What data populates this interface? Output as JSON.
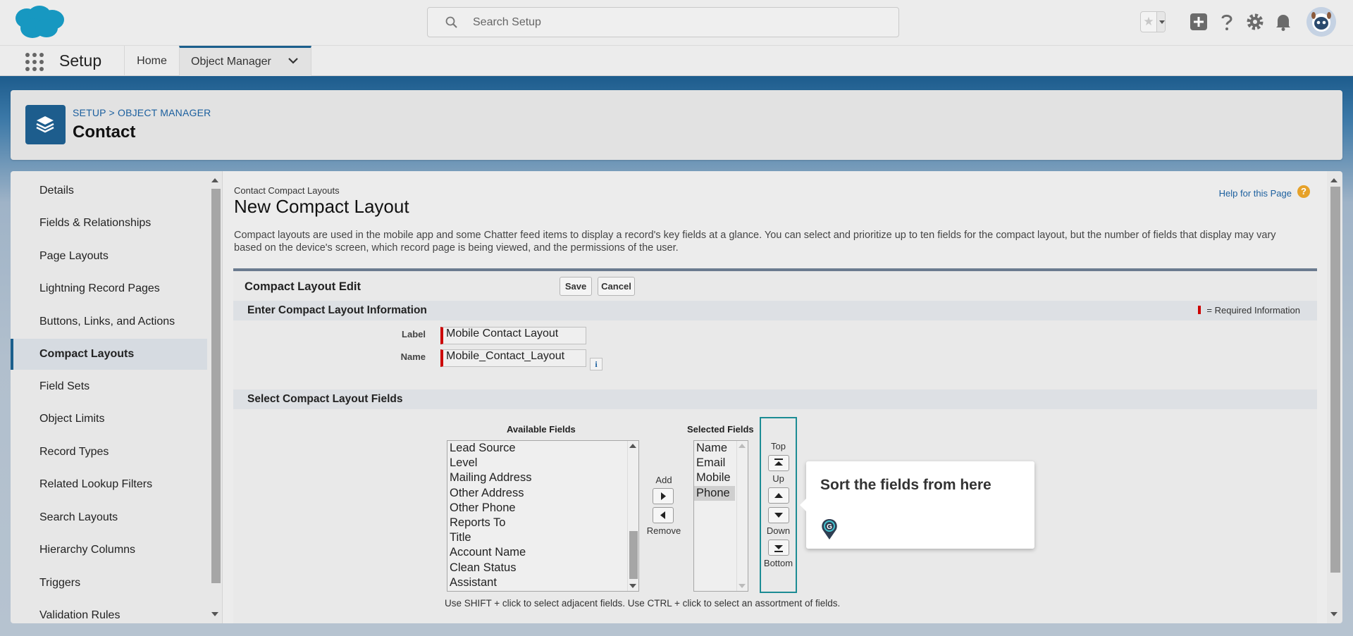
{
  "header": {
    "search_placeholder": "Search Setup"
  },
  "app_nav": {
    "app_name": "Setup",
    "tabs": [
      {
        "label": "Home"
      },
      {
        "label": "Object Manager"
      }
    ]
  },
  "page_header": {
    "breadcrumb": "SETUP > OBJECT MANAGER",
    "title": "Contact"
  },
  "sidebar": {
    "items": [
      {
        "label": "Details"
      },
      {
        "label": "Fields & Relationships"
      },
      {
        "label": "Page Layouts"
      },
      {
        "label": "Lightning Record Pages"
      },
      {
        "label": "Buttons, Links, and Actions"
      },
      {
        "label": "Compact Layouts",
        "active": true
      },
      {
        "label": "Field Sets"
      },
      {
        "label": "Object Limits"
      },
      {
        "label": "Record Types"
      },
      {
        "label": "Related Lookup Filters"
      },
      {
        "label": "Search Layouts"
      },
      {
        "label": "Hierarchy Columns"
      },
      {
        "label": "Triggers"
      },
      {
        "label": "Validation Rules"
      }
    ]
  },
  "content": {
    "kicker": "Contact Compact Layouts",
    "title": "New Compact Layout",
    "help_link": "Help for this Page",
    "help_icon": "?",
    "description": "Compact layouts are used in the mobile app and some Chatter feed items to display a record's key fields at a glance. You can select and prioritize up to ten fields for the compact layout, but the number of fields that display may vary based on the device's screen, which record page is being viewed, and the permissions of the user."
  },
  "edit": {
    "title": "Compact Layout Edit",
    "save_label": "Save",
    "cancel_label": "Cancel",
    "section_info": "Enter Compact Layout Information",
    "required_legend": "= Required Information",
    "label_label": "Label",
    "label_value": "Mobile Contact Layout",
    "name_label": "Name",
    "name_value": "Mobile_Contact_Layout",
    "info_icon": "i",
    "section_fields": "Select Compact Layout Fields"
  },
  "fields": {
    "available_caption": "Available Fields",
    "available": [
      "Lead Source",
      "Level",
      "Mailing Address",
      "Other Address",
      "Other Phone",
      "Reports To",
      "Title",
      "Account Name",
      "Clean Status",
      "Assistant"
    ],
    "selected_caption": "Selected Fields",
    "selected": [
      "Name",
      "Email",
      "Mobile",
      "Phone"
    ],
    "selected_highlight": "Phone",
    "add_label": "Add",
    "remove_label": "Remove",
    "sort_top": "Top",
    "sort_up": "Up",
    "sort_down": "Down",
    "sort_bottom": "Bottom",
    "hint": "Use SHIFT + click to select adjacent fields. Use CTRL + click to select an assortment of fields."
  },
  "tooltip": {
    "text": "Sort the fields from here",
    "icon": "guide-pin-icon"
  },
  "colors": {
    "brand_blue": "#1b5f8c",
    "required_red": "#c00000",
    "tooltip_outline": "#1c8c94",
    "salesforce_cloud": "#1798c1"
  }
}
